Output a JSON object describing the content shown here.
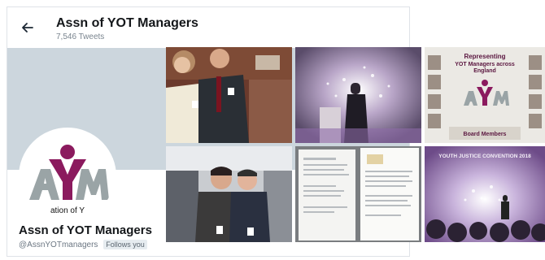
{
  "header": {
    "title": "Assn of YOT Managers",
    "tweet_count": "7,546 Tweets"
  },
  "profile": {
    "name": "Assn of YOT Managers",
    "handle": "@AssnYOTmanagers",
    "follows_badge": "Follows you",
    "logo_text": "AYM",
    "logo_caption": "ation of Y"
  },
  "media": {
    "poster_heading_1": "Representing",
    "poster_heading_2": "YOT Managers across",
    "poster_heading_3": "England",
    "poster_footer": "Board Members",
    "slide_heading": "YOUTH JUSTICE CONVENTION 2018"
  },
  "colors": {
    "brand_purple": "#8b1a5e",
    "brand_grey": "#9aa4a6",
    "banner": "#ccd6dd"
  }
}
